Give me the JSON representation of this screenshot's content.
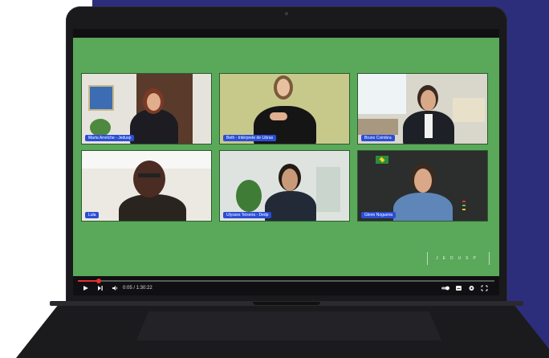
{
  "participants": [
    {
      "name": "Marta Arretche - Jedusp"
    },
    {
      "name": "Beth - Intérprete de Libras"
    },
    {
      "name": "Bruno Coimbra"
    },
    {
      "name": "Lula"
    },
    {
      "name": "Ulysses Teixeira - Dedp"
    },
    {
      "name": "Glenn Nogueira"
    }
  ],
  "player": {
    "time": "0:05 / 1:30:22",
    "progress_fraction": 0.05
  },
  "watermark": "JEDUSP",
  "colors": {
    "background_panel": "#2c2e7c",
    "video_background": "#5aa85a",
    "name_tag": "#2b4ed6",
    "progress": "#e53030"
  },
  "icons": [
    "play-icon",
    "next-icon",
    "volume-icon",
    "settings-icon",
    "subtitles-icon",
    "fullscreen-icon",
    "miniplayer-icon"
  ]
}
